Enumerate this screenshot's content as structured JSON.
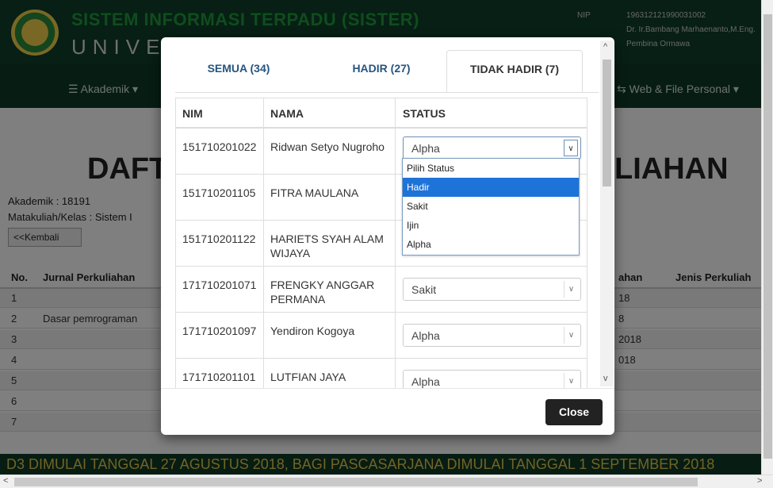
{
  "background": {
    "title": "SISTEM INFORMASI TERPADU (SISTER)",
    "university": "UNIVE",
    "nip_label": "NIP",
    "nip_value": "196312121990031002",
    "user_name": "Dr. Ir.Bambang Marhaenanto,M.Eng.",
    "user_role": "Pembina Ormawa",
    "nav_akademik": "☰ Akademik ▾",
    "nav_web": "⇆ Web & File Personal ▾",
    "heading_left": "DAFT",
    "heading_right": "LIAHAN",
    "akademik": "Akademik : 18191",
    "matakuliah": "Matakuliah/Kelas : Sistem I",
    "back_button": "<<Kembali",
    "columns": {
      "no": "No.",
      "jurnal": "Jurnal Perkuliahan",
      "tanggal": "ahan",
      "jenis": "Jenis Perkuliah"
    },
    "rows": [
      {
        "no": "1",
        "jurnal": "",
        "tanggal": "18"
      },
      {
        "no": "2",
        "jurnal": "Dasar pemrograman",
        "tanggal": "8"
      },
      {
        "no": "3",
        "jurnal": "",
        "tanggal": "2018"
      },
      {
        "no": "4",
        "jurnal": "",
        "tanggal": "018"
      },
      {
        "no": "5",
        "jurnal": "",
        "tanggal": ""
      },
      {
        "no": "6",
        "jurnal": "",
        "tanggal": ""
      },
      {
        "no": "7",
        "jurnal": "",
        "tanggal": ""
      }
    ],
    "banner": "D3 DIMULAI TANGGAL 27 AGUSTUS 2018, BAGI PASCASARJANA DIMULAI TANGGAL 1 SEPTEMBER 2018"
  },
  "modal": {
    "tabs": [
      "SEMUA (34)",
      "HADIR (27)",
      "TIDAK HADIR (7)"
    ],
    "active_tab": 2,
    "columns": {
      "nim": "NIM",
      "nama": "NAMA",
      "status": "STATUS"
    },
    "rows": [
      {
        "nim": "151710201022",
        "nama": "Ridwan Setyo Nugroho",
        "status": "Alpha"
      },
      {
        "nim": "151710201105",
        "nama": "FITRA MAULANA",
        "status": ""
      },
      {
        "nim": "151710201122",
        "nama": "HARIETS SYAH ALAM WIJAYA",
        "status": ""
      },
      {
        "nim": "171710201071",
        "nama": "FRENGKY ANGGAR PERMANA",
        "status": "Sakit"
      },
      {
        "nim": "171710201097",
        "nama": "Yendiron Kogoya",
        "status": "Alpha"
      },
      {
        "nim": "171710201101",
        "nama": "LUTFIAN JAYA",
        "status": "Alpha"
      }
    ],
    "dropdown_options": [
      "Pilih Status",
      "Hadir",
      "Sakit",
      "Ijin",
      "Alpha"
    ],
    "dropdown_highlighted": "Hadir",
    "close_label": "Close"
  }
}
